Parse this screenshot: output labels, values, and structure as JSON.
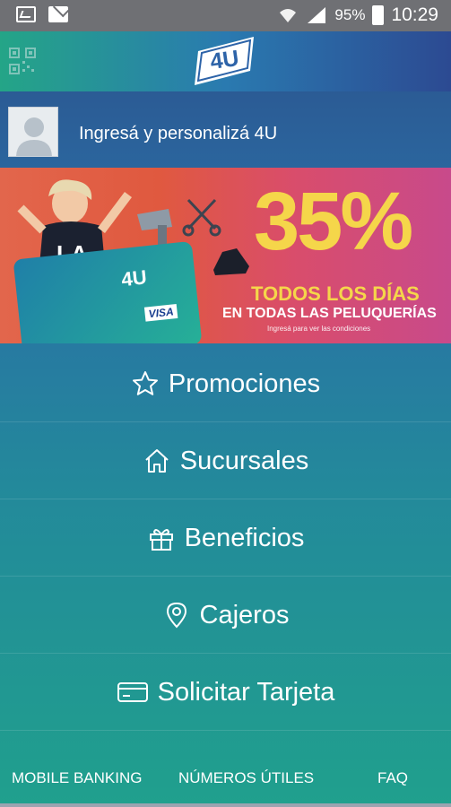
{
  "status_bar": {
    "battery_percent": "95%",
    "time": "10:29",
    "icons": [
      "image-icon",
      "mail-icon",
      "wifi-icon",
      "signal-icon",
      "battery-icon"
    ]
  },
  "header": {
    "logo_text": "4U",
    "qr_icon": "qr-code-icon"
  },
  "profile": {
    "prompt": "Ingresá y personalizá 4U"
  },
  "banner": {
    "percent": "35%",
    "line1": "TODOS LOS DÍAS",
    "line2": "EN TODAS LAS PELUQUERÍAS",
    "line3": "Ingresá para ver las condiciones",
    "card_logo": "4U",
    "card_brand": "VISA"
  },
  "menu": [
    {
      "label": "Promociones",
      "icon": "star-icon"
    },
    {
      "label": "Sucursales",
      "icon": "home-icon"
    },
    {
      "label": "Beneficios",
      "icon": "gift-icon"
    },
    {
      "label": "Cajeros",
      "icon": "location-pin-icon"
    },
    {
      "label": "Solicitar Tarjeta",
      "icon": "credit-card-icon"
    }
  ],
  "footer": {
    "mobile_banking": "MOBILE BANKING",
    "numeros_utiles": "NÚMEROS ÚTILES",
    "faq": "FAQ"
  },
  "colors": {
    "status_bar": "#6f7074",
    "banner_yellow": "#f5d64a",
    "menu_gradient_top": "#2c4f8a",
    "menu_gradient_bottom": "#20a08d"
  }
}
